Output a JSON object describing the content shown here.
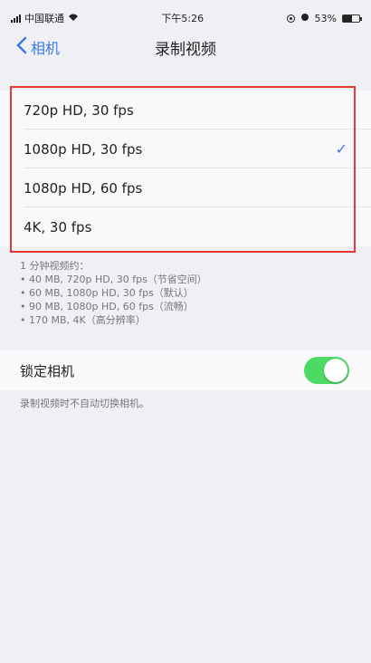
{
  "status_bar": {
    "carrier": "中国联通",
    "time": "下午5:26",
    "battery_percent": "53%",
    "battery_level": 0.53
  },
  "nav": {
    "back_label": "相机",
    "title": "录制视频"
  },
  "options": [
    {
      "label": "720p HD, 30 fps",
      "selected": false
    },
    {
      "label": "1080p HD, 30 fps",
      "selected": true
    },
    {
      "label": "1080p HD, 60 fps",
      "selected": false
    },
    {
      "label": "4K, 30 fps",
      "selected": false
    }
  ],
  "footnote": {
    "header": "1 分钟视频约：",
    "lines": [
      "• 40 MB, 720p HD, 30 fps（节省空间）",
      "• 60 MB, 1080p HD, 30 fps（默认）",
      "• 90 MB, 1080p HD, 60 fps（流畅）",
      "• 170 MB, 4K（高分辨率）"
    ]
  },
  "lock_camera": {
    "label": "锁定相机",
    "enabled": true,
    "footnote": "录制视频时不自动切换相机。"
  },
  "colors": {
    "accent": "#3b7be8",
    "toggle_on": "#4cd964",
    "highlight": "#e53935"
  }
}
